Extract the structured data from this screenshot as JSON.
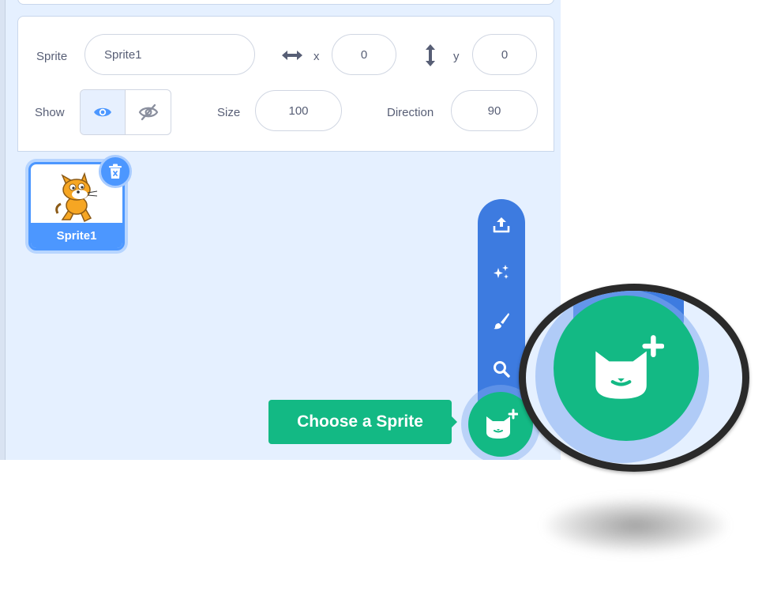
{
  "sprite_info": {
    "sprite_label": "Sprite",
    "sprite_name": "Sprite1",
    "x_label": "x",
    "x_value": "0",
    "y_label": "y",
    "y_value": "0",
    "show_label": "Show",
    "show_visible": true,
    "size_label": "Size",
    "size_value": "100",
    "direction_label": "Direction",
    "direction_value": "90"
  },
  "sprite_list": {
    "items": [
      {
        "label": "Sprite1",
        "selected": true
      }
    ]
  },
  "fab_menu": {
    "items": [
      "upload-icon",
      "surprise-icon",
      "paint-icon",
      "search-icon"
    ],
    "main_icon": "cat-add-icon"
  },
  "tooltip": {
    "text": "Choose a Sprite"
  },
  "colors": {
    "accent_blue": "#4c97ff",
    "menu_blue": "#3d7be0",
    "fab_green": "#13b984",
    "panel_bg": "#e5f0ff"
  }
}
